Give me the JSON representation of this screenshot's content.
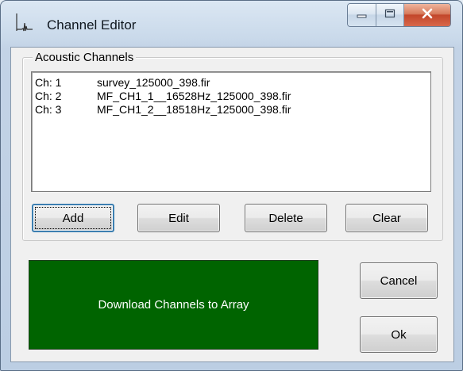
{
  "window": {
    "title": "Channel Editor",
    "app_icon": "waveform-icon",
    "controls": {
      "minimize": "minimize-icon",
      "maximize": "maximize-icon",
      "close": "close-icon"
    }
  },
  "acoustic_channels": {
    "label": "Acoustic Channels",
    "channels": [
      {
        "ch": "Ch: 1",
        "file": "survey_125000_398.fir"
      },
      {
        "ch": "Ch: 2",
        "file": "MF_CH1_1__16528Hz_125000_398.fir"
      },
      {
        "ch": "Ch: 3",
        "file": "MF_CH1_2__18518Hz_125000_398.fir"
      }
    ],
    "buttons": {
      "add": "Add",
      "edit": "Edit",
      "delete": "Delete",
      "clear": "Clear"
    }
  },
  "download_button": "Download Channels to Array",
  "cancel_button": "Cancel",
  "ok_button": "Ok",
  "colors": {
    "download_bg": "#006400",
    "close_btn": "#c2462a"
  }
}
